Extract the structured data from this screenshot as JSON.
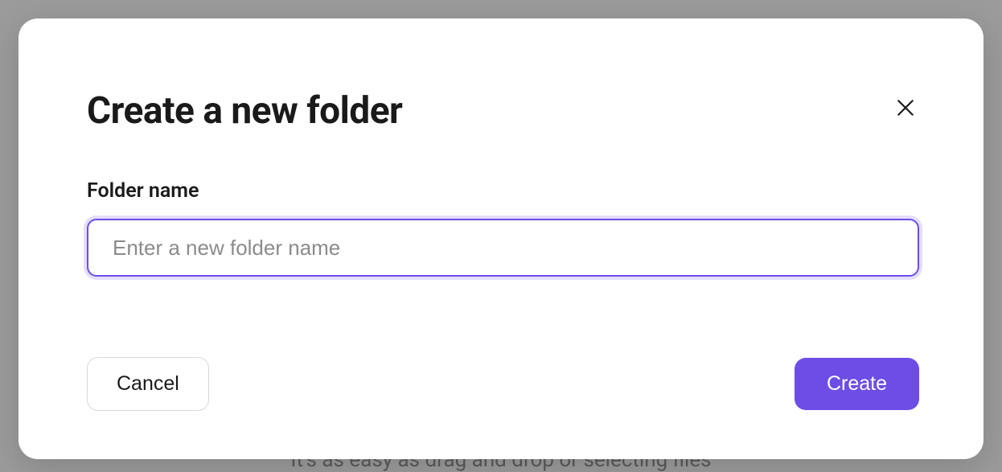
{
  "backdrop": {
    "hint_text": "It's as easy as drag and drop or selecting files"
  },
  "modal": {
    "title": "Create a new folder",
    "field_label": "Folder name",
    "input_placeholder": "Enter a new folder name",
    "input_value": "",
    "cancel_label": "Cancel",
    "create_label": "Create"
  },
  "colors": {
    "accent": "#6d4de6",
    "focus_ring": "#e5ddfb"
  }
}
